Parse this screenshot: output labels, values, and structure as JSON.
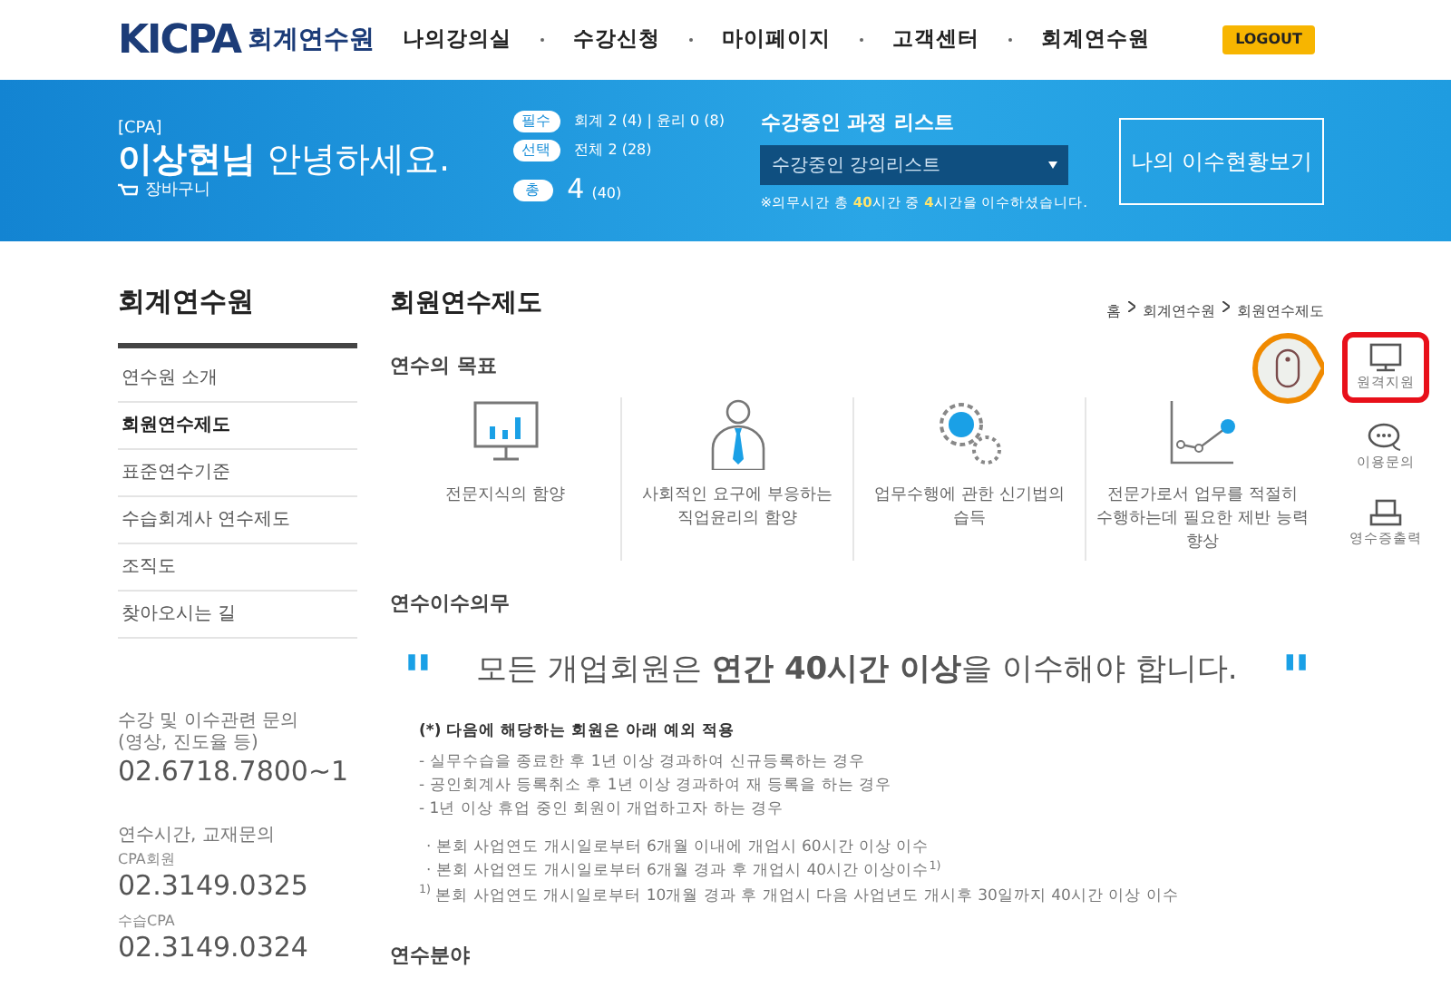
{
  "header": {
    "logo": {
      "mark": "KICPA",
      "text": "회계연수원"
    },
    "nav": [
      "나의강의실",
      "수강신청",
      "마이페이지",
      "고객센터",
      "회계연수원"
    ],
    "logout": "LOGOUT"
  },
  "banner": {
    "tag": "[CPA]",
    "greeting": "**이상현님** 안녕하세요.",
    "cart": "장바구니",
    "stats": [
      {
        "label": "필수",
        "value": "회계 2 (4) | 윤리 0 (8)"
      },
      {
        "label": "선택",
        "value": "전체 2 (28)"
      },
      {
        "label": "총",
        "value": "4",
        "sub": "(40)"
      }
    ],
    "course_list": {
      "title": "수강중인 과정 리스트",
      "value": "수강중인 강의리스트",
      "note": "※의무시간 총 **40**시간 중 **4**시간을 이수하셨습니다."
    },
    "status_button": "나의 이수현황보기"
  },
  "sidebar": {
    "title": "회계연수원",
    "items": [
      {
        "label": "연수원 소개",
        "selected": false
      },
      {
        "label": "회원연수제도",
        "selected": true
      },
      {
        "label": "표준연수기준",
        "selected": false
      },
      {
        "label": "수습회계사 연수제도",
        "selected": false
      },
      {
        "label": "조직도",
        "selected": false
      },
      {
        "label": "찾아오시는 길",
        "selected": false
      }
    ],
    "contacts": [
      {
        "label": "수강 및 이수관련 문의\n(영상, 진도율 등)",
        "number": "02.6718.7800~1"
      },
      {
        "label": "연수시간, 교재문의",
        "sublabel": "CPA회원",
        "number": "02.3149.0325"
      },
      {
        "sublabel": "수습CPA",
        "number": "02.3149.0324"
      }
    ]
  },
  "main": {
    "title": "회원연수제도",
    "breadcrumb": [
      "홈",
      "회계연수원",
      "회원연수제도"
    ],
    "goals": {
      "title": "연수의 목표",
      "items": [
        {
          "kind": "chart",
          "text": "전문지식의 함양"
        },
        {
          "kind": "person",
          "text": "사회적인 요구에 부응하는\n직업윤리의 함양"
        },
        {
          "kind": "gears",
          "text": "업무수행에 관한 신기법의\n습득"
        },
        {
          "kind": "line",
          "text": "전문가로서 업무를 적절히\n수행하는데 필요한 제반 능력\n향상"
        }
      ]
    },
    "duty": {
      "title": "연수이수의무",
      "open_mark": "\"",
      "quote": "모든 개업회원은 **연간 40시간 이상**을 이수해야 합니다.",
      "close_mark": "\"",
      "note_title": "(*) 다음에 해당하는 회원은 아래 예외 적용",
      "dash_items": [
        "- 실무수습을 종료한 후 1년 이상 경과하여 신규등록하는 경우",
        "- 공인회계사 등록취소 후 1년 이상 경과하여 재 등록을 하는 경우",
        "- 1년 이상 휴업 중인 회원이 개업하고자 하는 경우"
      ],
      "dot_items": [
        "·  본회 사업연도 개시일로부터 6개월 이내에 개업시 60시간 이상 이수",
        "·  본회 사업연도 개시일로부터 6개월 경과 후 개업시 40시간 이상이수$^{1)}$"
      ],
      "footnote": "$^{1)}$ 본회 사업연도 개시일로부터 10개월 경과 후 개업시 다음 사업년도 개시후 30일까지 40시간 이상 이수"
    },
    "fields": {
      "title": "연수분야"
    }
  },
  "quick_menu": [
    {
      "kind": "monitor",
      "label": "원격지원",
      "selected": true
    },
    {
      "kind": "chat",
      "label": "이용문의",
      "selected": false
    },
    {
      "kind": "printer",
      "label": "영수증출력",
      "selected": false
    }
  ]
}
